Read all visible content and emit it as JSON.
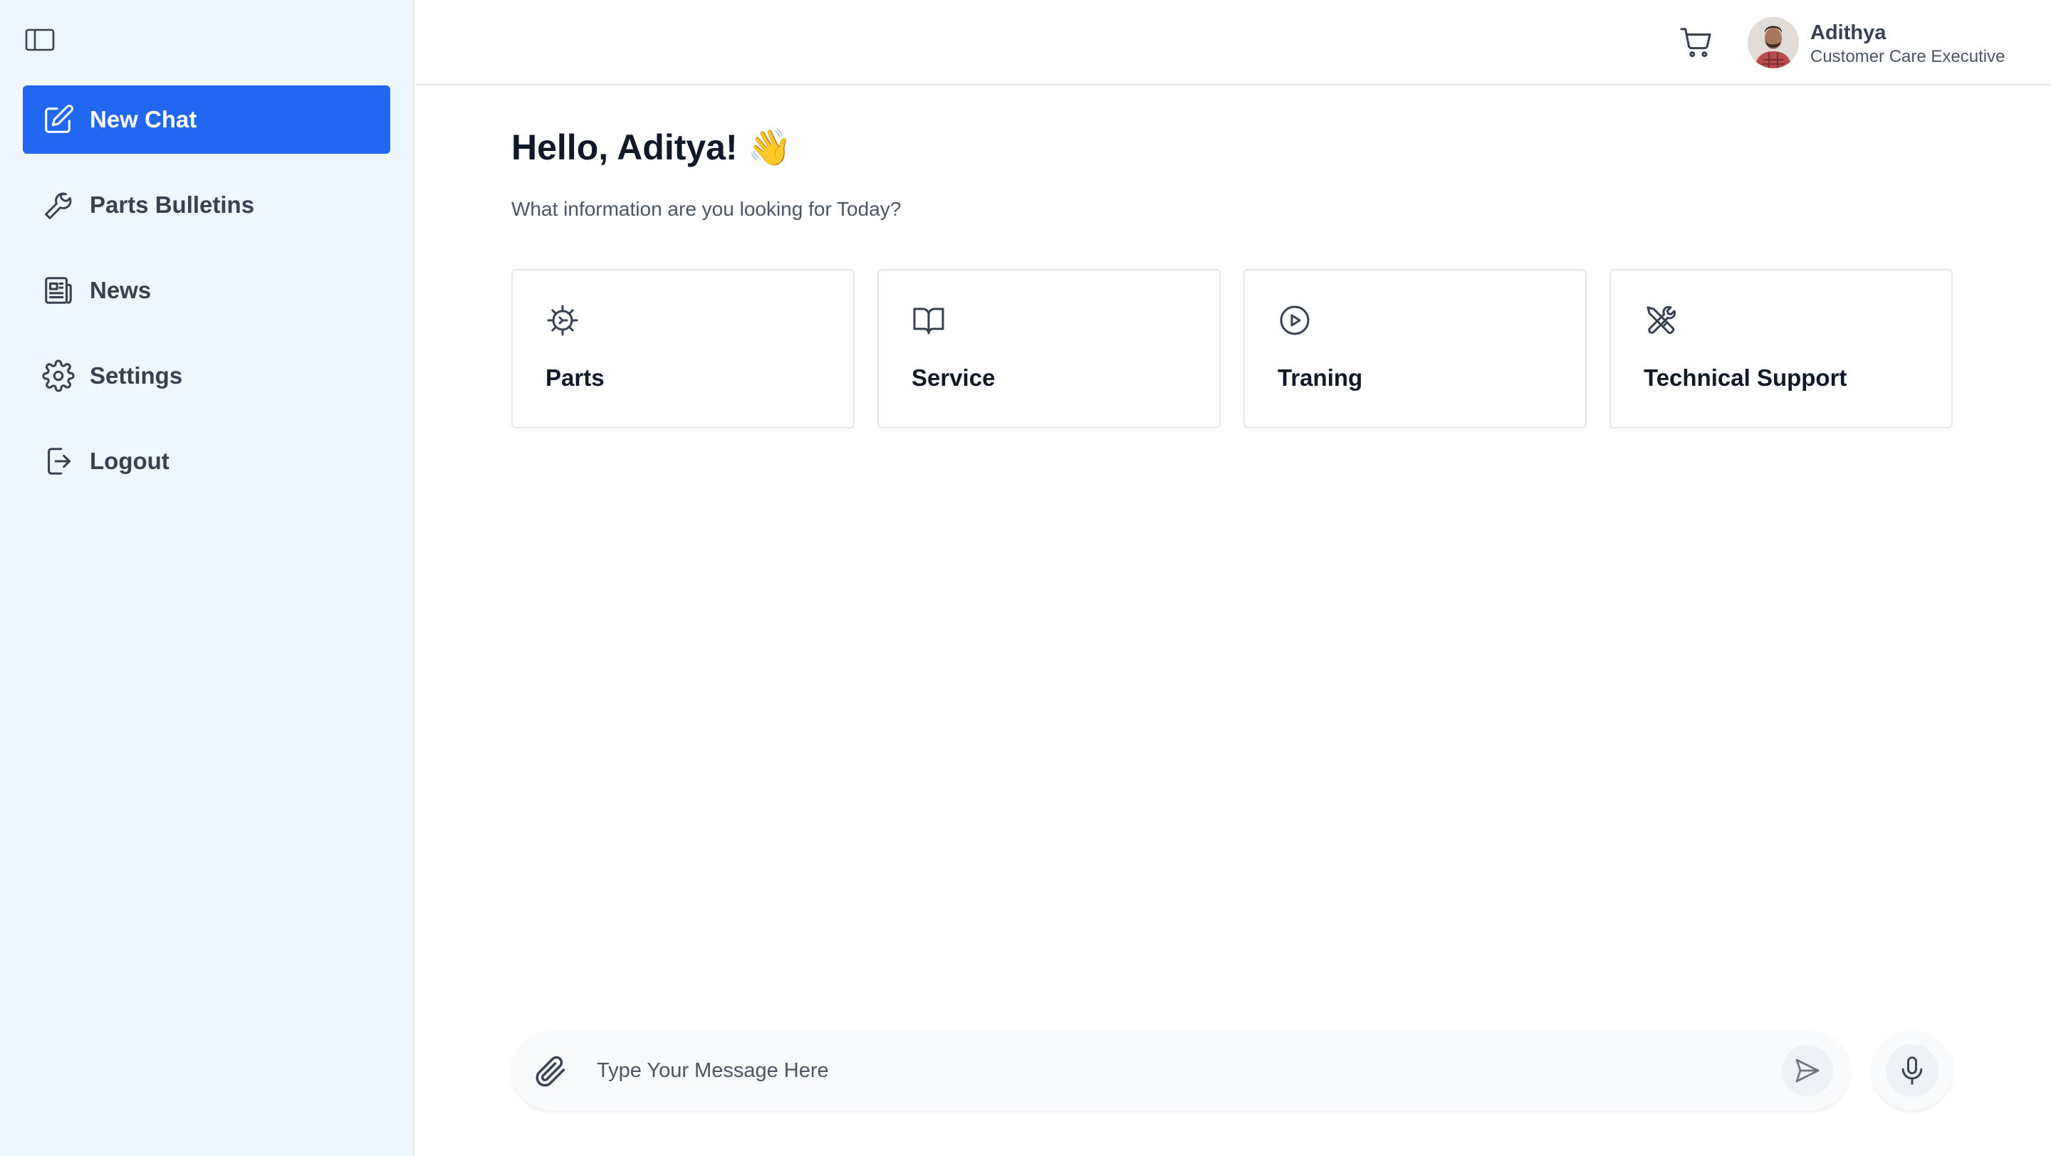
{
  "sidebar": {
    "items": [
      {
        "label": "New Chat",
        "icon": "edit-icon",
        "active": true
      },
      {
        "label": "Parts Bulletins",
        "icon": "wrench-icon"
      },
      {
        "label": "News",
        "icon": "newspaper-icon"
      },
      {
        "label": "Settings",
        "icon": "gear-icon"
      },
      {
        "label": "Logout",
        "icon": "logout-icon"
      }
    ]
  },
  "header": {
    "user": {
      "name": "Adithya",
      "role": "Customer Care Executive"
    }
  },
  "main": {
    "greeting": "Hello, Aditya! 👋",
    "subtitle": "What information are you looking for Today?",
    "cards": [
      {
        "label": "Parts",
        "icon": "gear-cog-icon"
      },
      {
        "label": "Service",
        "icon": "book-icon"
      },
      {
        "label": "Traning",
        "icon": "play-circle-icon"
      },
      {
        "label": "Technical Support",
        "icon": "tools-icon"
      }
    ]
  },
  "composer": {
    "placeholder": "Type Your Message Here"
  },
  "colors": {
    "accent": "#2167f2",
    "sidebar_bg": "#eef6fe"
  }
}
